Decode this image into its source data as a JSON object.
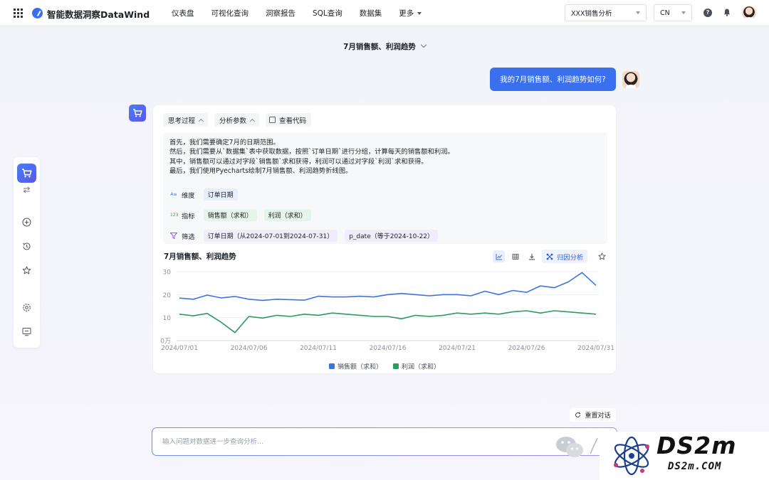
{
  "app": {
    "title": "智能数据洞察DataWind"
  },
  "nav": {
    "items": [
      "仪表盘",
      "可视化查询",
      "洞察报告",
      "SQL查询",
      "数据集"
    ],
    "more": "更多"
  },
  "header": {
    "dataset_select": "XXX销售分析",
    "lang_select": "CN"
  },
  "conversation": {
    "title": "7月销售额、利润趋势"
  },
  "user_message": "我的7月销售额、利润趋势如何?",
  "answer": {
    "tabs": {
      "thinking": "思考过程",
      "params": "分析参数",
      "code": "查看代码"
    },
    "reasoning": [
      "首先，我们需要确定7月的日期范围。",
      "然后，我们需要从`数据集`表中获取数据，按照`订单日期`进行分组，计算每天的销售额和利润。",
      "其中，销售额可以通过对字段`销售额`求和获得，利润可以通过对字段`利润`求和获得。",
      "最后，我们使用Pyecharts绘制7月销售额、利润趋势折线图。"
    ],
    "params": {
      "dimension": {
        "icon_text": "A≡",
        "label": "维度",
        "chips": [
          "订单日期"
        ]
      },
      "metric": {
        "icon_text": "123",
        "label": "指标",
        "chips": [
          "销售额（求和）",
          "利润（求和）"
        ]
      },
      "filter": {
        "label": "筛选",
        "chips": [
          "订单日期（从2024-07-01到2024-07-31）",
          "p_date（等于2024-10-22）"
        ]
      }
    },
    "attribution_button": "归因分析"
  },
  "chart_data": {
    "type": "line",
    "title": "7月销售额、利润趋势",
    "x": [
      "2024/07/01",
      "2024/07/02",
      "2024/07/03",
      "2024/07/04",
      "2024/07/05",
      "2024/07/06",
      "2024/07/07",
      "2024/07/08",
      "2024/07/09",
      "2024/07/10",
      "2024/07/11",
      "2024/07/12",
      "2024/07/13",
      "2024/07/14",
      "2024/07/15",
      "2024/07/16",
      "2024/07/17",
      "2024/07/18",
      "2024/07/19",
      "2024/07/20",
      "2024/07/21",
      "2024/07/22",
      "2024/07/23",
      "2024/07/24",
      "2024/07/25",
      "2024/07/26",
      "2024/07/27",
      "2024/07/28",
      "2024/07/29",
      "2024/07/30",
      "2024/07/31"
    ],
    "x_ticks": [
      "2024/07/01",
      "2024/07/06",
      "2024/07/11",
      "2024/07/16",
      "2024/07/21",
      "2024/07/26",
      "2024/07/31"
    ],
    "y_ticks": [
      "0万",
      "10",
      "20",
      "30"
    ],
    "ylim": [
      0,
      30
    ],
    "series": [
      {
        "name": "销售额（求和）",
        "color": "#3f73e0",
        "values": [
          18.5,
          18.0,
          19.8,
          18.6,
          19.2,
          18.0,
          17.5,
          18.0,
          17.8,
          17.6,
          19.3,
          19.0,
          19.0,
          19.3,
          19.0,
          20.0,
          20.5,
          20.0,
          19.5,
          20.0,
          20.0,
          19.5,
          21.5,
          20.0,
          21.8,
          21.0,
          23.8,
          23.0,
          25.5,
          29.6,
          24.0
        ]
      },
      {
        "name": "利润（求和）",
        "color": "#2e9a5c",
        "values": [
          11.5,
          10.8,
          11.8,
          8.0,
          3.5,
          10.5,
          9.8,
          11.0,
          10.5,
          11.5,
          11.0,
          12.0,
          11.5,
          11.0,
          10.5,
          10.5,
          9.5,
          11.0,
          10.5,
          11.0,
          12.0,
          11.5,
          12.0,
          11.5,
          12.5,
          13.0,
          12.0,
          13.0,
          12.5,
          12.0,
          11.5
        ]
      }
    ],
    "legend": "bottom",
    "grid": "horizontal"
  },
  "footer": {
    "reset": "重置对话",
    "input_placeholder": "输入问题对数据进一步查询分析..."
  },
  "watermark": {
    "big": "DS2m",
    "small": "DS2m.COM"
  }
}
